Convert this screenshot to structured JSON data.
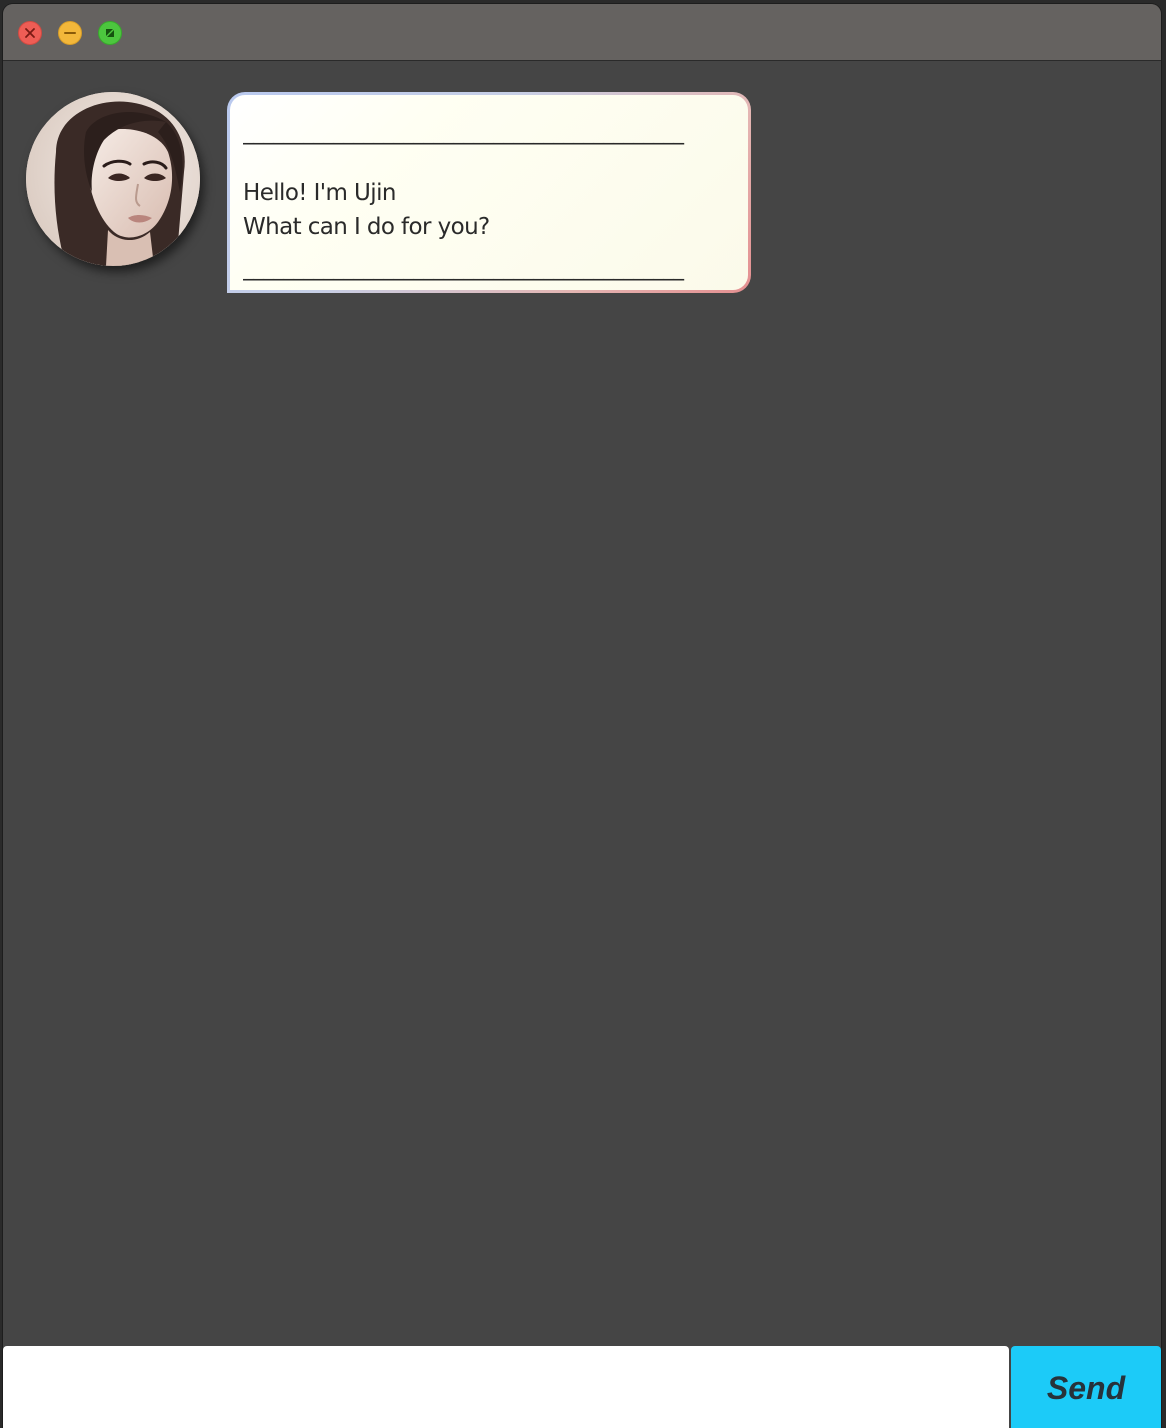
{
  "window": {
    "title": "",
    "controls": {
      "close_icon": "close-icon",
      "minimize_icon": "minimize-icon",
      "maximize_icon": "maximize-icon"
    }
  },
  "chat": {
    "messages": [
      {
        "sender": "bot",
        "avatar_icon": "avatar-portrait",
        "divider_top": "____________________________________________",
        "lines": [
          "Hello! I'm Ujin",
          "What can I do for you?"
        ],
        "divider_bottom": "____________________________________________"
      }
    ]
  },
  "input": {
    "value": "",
    "placeholder": ""
  },
  "send_button": {
    "label": "Send"
  },
  "colors": {
    "background": "#454545",
    "titlebar": "#656260",
    "send_button": "#1ccbf8",
    "bubble_fill": "#fffff3",
    "close": "#ee5d55",
    "minimize": "#f3b73a",
    "maximize": "#4cc63e"
  }
}
